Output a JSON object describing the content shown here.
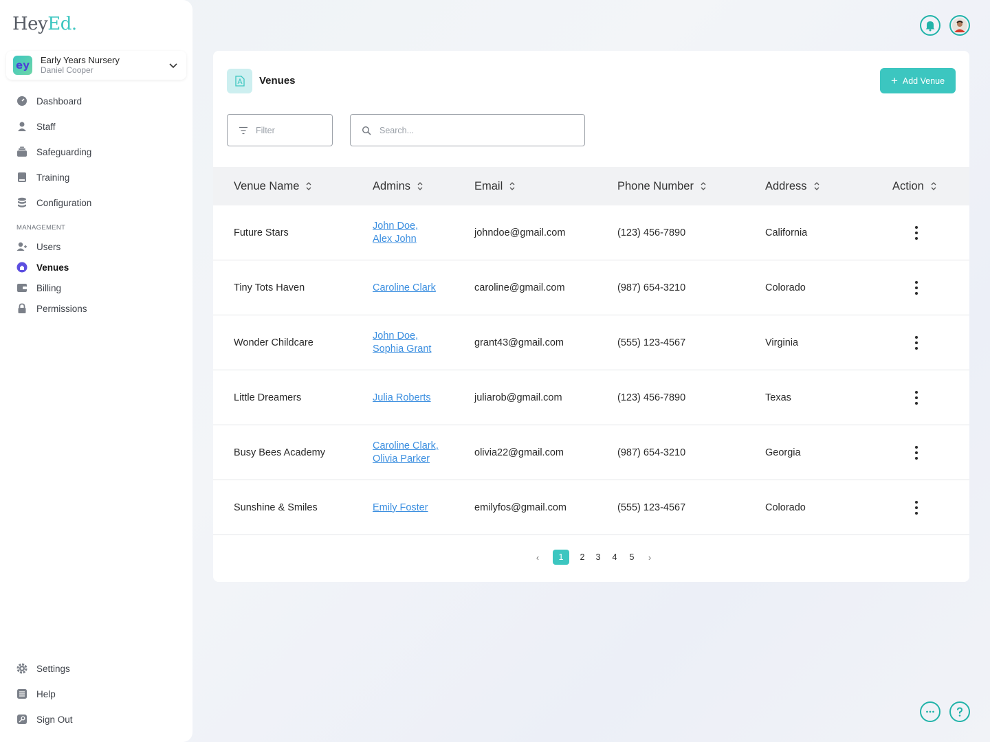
{
  "brand": {
    "name_main": "Hey",
    "name_accent": "Ed."
  },
  "org": {
    "name": "Early Years Nursery",
    "user": "Daniel Cooper",
    "logo_text": "ey"
  },
  "nav": {
    "items": [
      {
        "label": "Dashboard",
        "icon": "dashboard-icon"
      },
      {
        "label": "Staff",
        "icon": "person-icon"
      },
      {
        "label": "Safeguarding",
        "icon": "layers-icon"
      },
      {
        "label": "Training",
        "icon": "book-icon"
      },
      {
        "label": "Configuration",
        "icon": "database-icon"
      }
    ],
    "section_label": "MANAGEMENT",
    "management": [
      {
        "label": "Users",
        "icon": "add-user-icon"
      },
      {
        "label": "Venues",
        "icon": "home-icon"
      },
      {
        "label": "Billing",
        "icon": "wallet-icon"
      },
      {
        "label": "Permissions",
        "icon": "lock-icon"
      }
    ],
    "bottom": [
      {
        "label": "Settings",
        "icon": "gear-icon"
      },
      {
        "label": "Help",
        "icon": "list-icon"
      },
      {
        "label": "Sign Out",
        "icon": "key-icon"
      }
    ]
  },
  "page": {
    "title": "Venues",
    "add_button": "Add Venue",
    "filter_label": "Filter",
    "search_placeholder": "Search..."
  },
  "table": {
    "columns": [
      "Venue Name",
      "Admins",
      "Email",
      "Phone Number",
      "Address",
      "Action"
    ],
    "rows": [
      {
        "venue": "Future Stars",
        "admins": [
          "John Doe,",
          "Alex John"
        ],
        "email": "johndoe@gmail.com",
        "phone": "(123) 456-7890",
        "address": "California"
      },
      {
        "venue": "Tiny Tots Haven",
        "admins": [
          "Caroline Clark"
        ],
        "email": "caroline@gmail.com",
        "phone": "(987) 654-3210",
        "address": "Colorado"
      },
      {
        "venue": "Wonder Childcare",
        "admins": [
          "John Doe,",
          "Sophia Grant"
        ],
        "email": "grant43@gmail.com",
        "phone": "(555) 123-4567",
        "address": "Virginia"
      },
      {
        "venue": "Little Dreamers",
        "admins": [
          "Julia Roberts"
        ],
        "email": "juliarob@gmail.com",
        "phone": "(123) 456-7890",
        "address": "Texas"
      },
      {
        "venue": "Busy Bees Academy",
        "admins": [
          "Caroline Clark,",
          "Olivia Parker"
        ],
        "email": "olivia22@gmail.com",
        "phone": "(987) 654-3210",
        "address": "Georgia"
      },
      {
        "venue": "Sunshine & Smiles",
        "admins": [
          "Emily Foster"
        ],
        "email": "emilyfos@gmail.com",
        "phone": "(555) 123-4567",
        "address": "Colorado"
      }
    ]
  },
  "pagination": {
    "prev": "‹",
    "pages": [
      "1",
      "2",
      "3",
      "4",
      "5"
    ],
    "current": "1",
    "next": "›"
  },
  "colors": {
    "accent": "#3cc6c0",
    "link": "#3c8fe0",
    "icon_ring": "#21b3a9"
  }
}
